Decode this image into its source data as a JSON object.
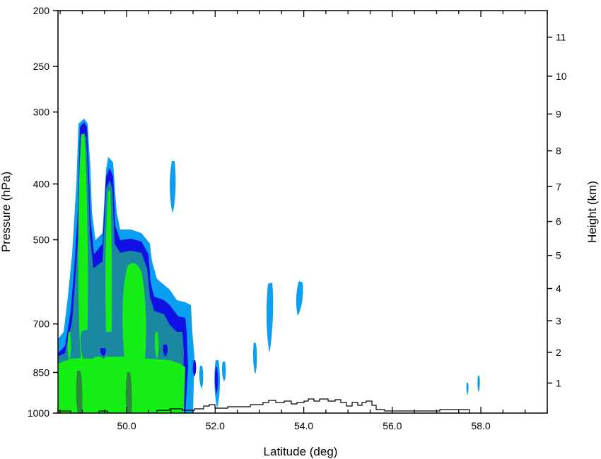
{
  "chart_data": {
    "type": "contour-cross-section",
    "xlabel": "Latitude (deg)",
    "ylabel_left": "Pressure (hPa)",
    "ylabel_right": "Height (km)",
    "x_ticks": [
      {
        "value": 50.0,
        "label": "50.0"
      },
      {
        "value": 52.0,
        "label": "52.0"
      },
      {
        "value": 54.0,
        "label": "54.0"
      },
      {
        "value": 56.0,
        "label": "56.0"
      },
      {
        "value": 58.0,
        "label": "58.0"
      }
    ],
    "xlim": [
      48.45,
      59.5
    ],
    "y_left_ticks": [
      {
        "value": 200,
        "label": "200"
      },
      {
        "value": 250,
        "label": "250"
      },
      {
        "value": 300,
        "label": "300"
      },
      {
        "value": 400,
        "label": "400"
      },
      {
        "value": 500,
        "label": "500"
      },
      {
        "value": 700,
        "label": "700"
      },
      {
        "value": 850,
        "label": "850"
      },
      {
        "value": 1000,
        "label": "1000"
      }
    ],
    "y_left_scale": "log",
    "ylim_left": [
      1000,
      200
    ],
    "y_right_ticks": [
      {
        "value": 1,
        "label": "1"
      },
      {
        "value": 2,
        "label": "2"
      },
      {
        "value": 3,
        "label": "3"
      },
      {
        "value": 4,
        "label": "4"
      },
      {
        "value": 5,
        "label": "5"
      },
      {
        "value": 6,
        "label": "6"
      },
      {
        "value": 7,
        "label": "7"
      },
      {
        "value": 8,
        "label": "8"
      },
      {
        "value": 9,
        "label": "9"
      },
      {
        "value": 10,
        "label": "10"
      },
      {
        "value": 11,
        "label": "11"
      }
    ],
    "fill_colors": {
      "level1": "#0a9ff2",
      "level2": "#1111e6",
      "level3": "#1a88a0",
      "level4": "#16ef16",
      "level5": "#2a8a3a"
    },
    "terrain_line_color": "#000000",
    "grid": false,
    "legend": "none"
  }
}
